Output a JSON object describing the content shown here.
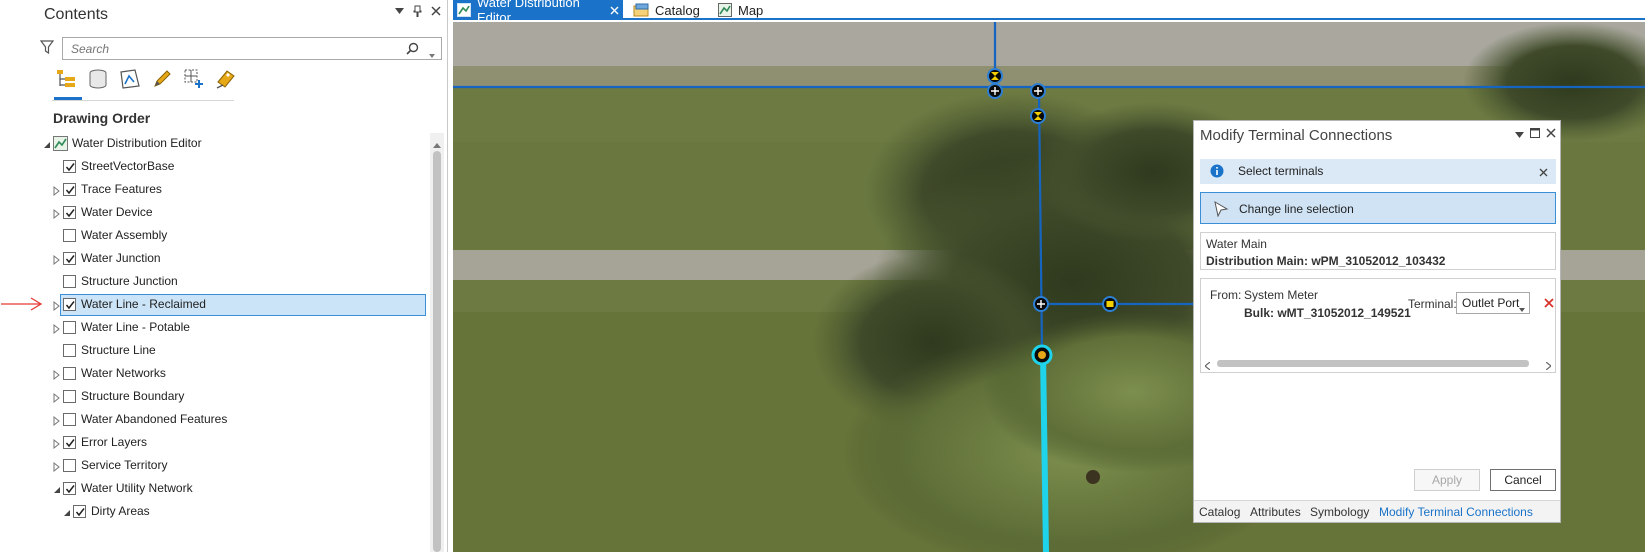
{
  "contents": {
    "title": "Contents",
    "search_placeholder": "Search",
    "section_title": "Drawing Order",
    "tree": [
      {
        "label": "Water Distribution Editor",
        "level": 0,
        "expander": "expanded",
        "checked": null,
        "map_icon": true
      },
      {
        "label": "StreetVectorBase",
        "level": 1,
        "expander": "none",
        "checked": true
      },
      {
        "label": "Trace Features",
        "level": 1,
        "expander": "collapsed",
        "checked": true
      },
      {
        "label": "Water Device",
        "level": 1,
        "expander": "collapsed",
        "checked": true
      },
      {
        "label": "Water Assembly",
        "level": 1,
        "expander": "none",
        "checked": false
      },
      {
        "label": "Water Junction",
        "level": 1,
        "expander": "collapsed",
        "checked": true
      },
      {
        "label": "Structure Junction",
        "level": 1,
        "expander": "none",
        "checked": false
      },
      {
        "label": "Water Line - Reclaimed",
        "level": 1,
        "expander": "collapsed",
        "checked": true,
        "selected": true
      },
      {
        "label": "Water Line - Potable",
        "level": 1,
        "expander": "collapsed",
        "checked": false
      },
      {
        "label": "Structure Line",
        "level": 1,
        "expander": "none",
        "checked": false
      },
      {
        "label": "Water Networks",
        "level": 1,
        "expander": "collapsed",
        "checked": false
      },
      {
        "label": "Structure Boundary",
        "level": 1,
        "expander": "collapsed",
        "checked": false
      },
      {
        "label": "Water Abandoned Features",
        "level": 1,
        "expander": "collapsed",
        "checked": false
      },
      {
        "label": "Error Layers",
        "level": 1,
        "expander": "collapsed",
        "checked": true
      },
      {
        "label": "Service Territory",
        "level": 1,
        "expander": "collapsed",
        "checked": false
      },
      {
        "label": "Water Utility Network",
        "level": 1,
        "expander": "expanded",
        "checked": true
      },
      {
        "label": "Dirty Areas",
        "level": 2,
        "expander": "expanded",
        "checked": true
      }
    ]
  },
  "tabs": [
    {
      "label": "Water Distribution Editor",
      "active": true
    },
    {
      "label": "Catalog",
      "active": false
    },
    {
      "label": "Map",
      "active": false
    }
  ],
  "mtc": {
    "title": "Modify Terminal Connections",
    "info_text": "Select terminals",
    "change_label": "Change line selection",
    "line_layer": "Water Main",
    "line_id": "Distribution Main: wPM_31052012_103432",
    "from_label": "From:",
    "from_value": "System Meter",
    "from_id": "Bulk: wMT_31052012_149521",
    "terminal_label": "Terminal:",
    "terminal_value": "Outlet Port",
    "apply_label": "Apply",
    "cancel_label": "Cancel",
    "bottom_tabs": [
      "Catalog",
      "Attributes",
      "Symbology",
      "Modify Terminal Connections"
    ],
    "active_bottom_tab": "Modify Terminal Connections"
  },
  "colors": {
    "accent": "#1a73c8",
    "pipe": "#1565c0",
    "reclaimed": "#1fd4ea",
    "delete": "#d9342b",
    "annotation_arrow": "#e53935"
  }
}
